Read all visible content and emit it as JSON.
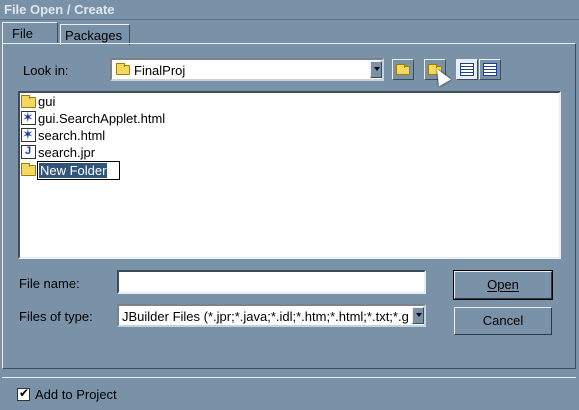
{
  "window": {
    "title": "File Open / Create"
  },
  "tabs": [
    {
      "label": "File"
    },
    {
      "label": "Packages"
    }
  ],
  "look_in": {
    "label": "Look in:",
    "value": "FinalProj"
  },
  "files": [
    {
      "name": "gui",
      "icon": "folder-icon"
    },
    {
      "name": "gui.SearchApplet.html",
      "icon": "html-file-icon"
    },
    {
      "name": "search.html",
      "icon": "html-file-icon"
    },
    {
      "name": "search.jpr",
      "icon": "jpr-file-icon"
    },
    {
      "name": "New Folder",
      "icon": "folder-icon",
      "editing": true
    }
  ],
  "file_name": {
    "label": "File name:",
    "value": ""
  },
  "files_of_type": {
    "label": "Files of type:",
    "value": "JBuilder Files (*.jpr;*.java;*.idl;*.htm;*.html;*.txt;*.gif;"
  },
  "buttons": {
    "open": "Open",
    "cancel": "Cancel"
  },
  "add_to_project": {
    "label": "Add to Project",
    "checked": true,
    "check_glyph": "✔"
  },
  "colors": {
    "background": "#7a92a8",
    "selection": "#31557a"
  }
}
